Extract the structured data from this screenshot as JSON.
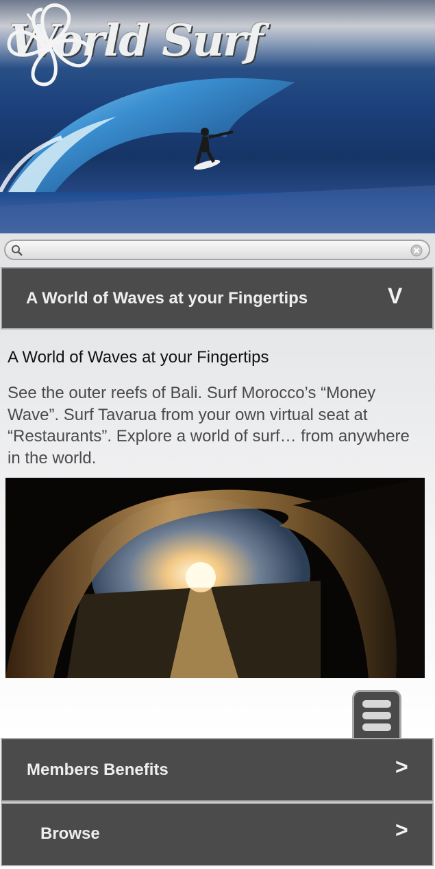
{
  "header": {
    "logo_text": "World Surf",
    "logo_icon": "hibiscus-flower-icon"
  },
  "search": {
    "value": "",
    "placeholder": "",
    "search_icon": "search-icon",
    "clear_icon": "clear-icon"
  },
  "accordion": {
    "open_section": {
      "label": "A World of Waves at your Fingertips",
      "chevron": "V"
    },
    "sections": [
      {
        "label": "Members Benefits",
        "chevron": ">"
      },
      {
        "label": "Browse",
        "chevron": ">"
      }
    ]
  },
  "content": {
    "title": "A World of Waves at your Fingertips",
    "body": "See the outer reefs of Bali. Surf Morocco’s “Money Wave”. Surf Tavarua from your own virtual seat at “Restaurants”.  Explore a world of surf… from anywhere in the world."
  },
  "menu_button": {
    "icon": "menu-icon"
  },
  "colors": {
    "bar_background": "#4b4b4b",
    "bar_text": "#eeeeee",
    "bar_border": "#a9a9a9",
    "body_text": "#4a4a4a"
  }
}
